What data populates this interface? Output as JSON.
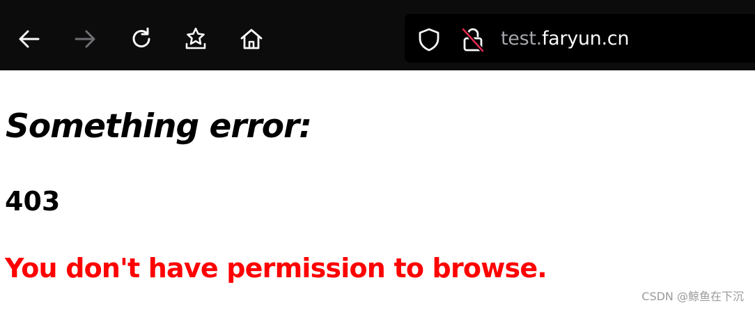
{
  "toolbar": {
    "buttons": [
      {
        "name": "back",
        "icon": "arrow-left-icon",
        "enabled": true
      },
      {
        "name": "forward",
        "icon": "arrow-right-icon",
        "enabled": false
      },
      {
        "name": "reload",
        "icon": "reload-icon",
        "enabled": true
      },
      {
        "name": "bookmarks",
        "icon": "star-tray-icon",
        "enabled": true
      },
      {
        "name": "home",
        "icon": "home-icon",
        "enabled": true
      }
    ],
    "address": {
      "url_prefix": "test.",
      "url_domain": "faryun.cn",
      "tracking_icon": "shield-icon",
      "security_icon": "insecure-lock-icon"
    }
  },
  "page": {
    "heading": "Something error:",
    "status_code": "403",
    "message": "You don't have permission to browse."
  },
  "watermark": "CSDN @鲸鱼在下沉",
  "colors": {
    "toolbar_bg": "#0c0c0d",
    "urlbar_bg": "#000000",
    "icon": "#fbfbfe",
    "icon_disabled": "#6e6e73",
    "error_message": "#ff0000",
    "insecure_strike": "#e22850"
  }
}
